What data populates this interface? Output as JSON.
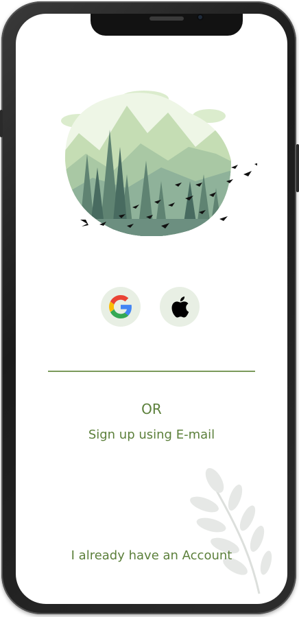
{
  "colors": {
    "accent": "#5b7f3a",
    "divider": "#7a9a5a",
    "social_button_bg": "#e8efe4",
    "frame": "#1b1b1b"
  },
  "hero": {
    "image": "forest-mountains-birds-illustration"
  },
  "social": {
    "google_icon": "google-icon",
    "apple_icon": "apple-icon"
  },
  "auth": {
    "or_label": "OR",
    "email_signup_label": "Sign up using E-mail",
    "existing_account_label": "I already have an Account"
  },
  "decor": {
    "leaf": "leaf-branch-illustration"
  }
}
